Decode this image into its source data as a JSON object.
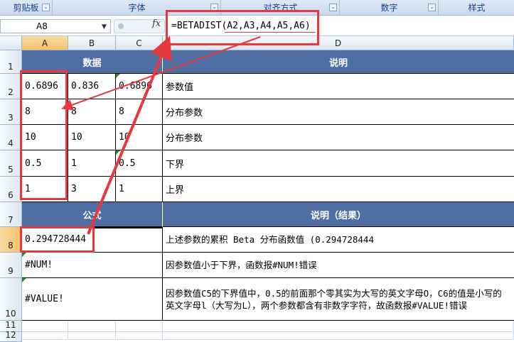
{
  "ribbon": {
    "groups": [
      {
        "label": "剪贴板",
        "launcher": "⌄"
      },
      {
        "label": "字体",
        "launcher": "⌄"
      },
      {
        "label": "对齐方式",
        "launcher": "⌄"
      },
      {
        "label": "数字",
        "launcher": "⌄"
      },
      {
        "label": "样式",
        "launcher": ""
      }
    ]
  },
  "formula_bar": {
    "name_box": "A8",
    "fx_label": "fx",
    "formula": "=BETADIST(A2,A3,A4,A5,A6)"
  },
  "columns": [
    "A",
    "B",
    "C",
    "D"
  ],
  "rows": [
    "1",
    "2",
    "3",
    "4",
    "5",
    "6",
    "7",
    "8",
    "9",
    "10",
    "11",
    "12"
  ],
  "sheet": {
    "header_data": "数据",
    "header_desc": "说明",
    "data_rows": [
      {
        "a": "0.6896",
        "b": "0.836",
        "c": "0.6896",
        "d": "参数值"
      },
      {
        "a": "8",
        "b": "8",
        "c": "8",
        "d": "分布参数"
      },
      {
        "a": "10",
        "b": "10",
        "c": "10",
        "d": "分布参数"
      },
      {
        "a": "0.5",
        "b": "1",
        "c": "0.5",
        "d": "下界"
      },
      {
        "a": "1",
        "b": "3",
        "c": "1",
        "d": "上界"
      }
    ],
    "header_formula": "公式",
    "header_result": "说明（结果）",
    "result_rows": [
      {
        "a": "0.294728444",
        "d": "上述参数的累积 Beta 分布函数值 (0.294728444"
      },
      {
        "a": "#NUM!",
        "d": "因参数值小于下界，函数报#NUM!错误"
      },
      {
        "a": "#VALUE!",
        "d": "因参数值C5的下界值中，0.5的前面那个零其实为大写的英文字母O，C6的值是小写的英文字母l（大写为L），两个参数都含有非数字字符，故函数报#VALUE!错误"
      }
    ]
  },
  "colors": {
    "header_bg": "#4f6fa3",
    "annotation": "#e8383d"
  }
}
